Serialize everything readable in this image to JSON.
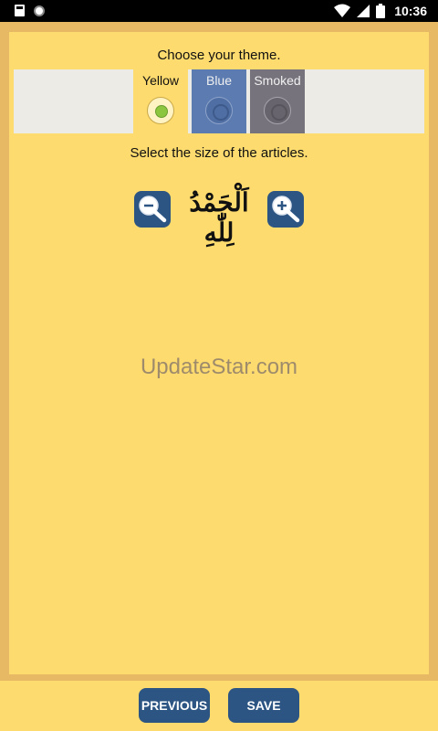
{
  "status_bar": {
    "time": "10:36",
    "icons": [
      "sd-card-icon",
      "notification-dot-icon",
      "wifi-icon",
      "signal-icon",
      "battery-icon"
    ]
  },
  "theme": {
    "prompt": "Choose your theme.",
    "options": [
      {
        "name": "Yellow",
        "selected": true,
        "color": "#fedb6e"
      },
      {
        "name": "Blue",
        "selected": false,
        "color": "#5b7bb1"
      },
      {
        "name": "Smoked",
        "selected": false,
        "color": "#76737c"
      }
    ]
  },
  "size": {
    "prompt": "Select the size of the articles.",
    "sample_text": "اَلْحَمْدُ لِلّٰهِ",
    "zoom_out_icon": "zoom-out-icon",
    "zoom_in_icon": "zoom-in-icon"
  },
  "watermark": "UpdateStar.com",
  "buttons": {
    "previous": "PREVIOUS",
    "save": "SAVE"
  },
  "colors": {
    "accent": "#2c5584",
    "background": "#fedb6e",
    "frame": "#e8b964"
  }
}
